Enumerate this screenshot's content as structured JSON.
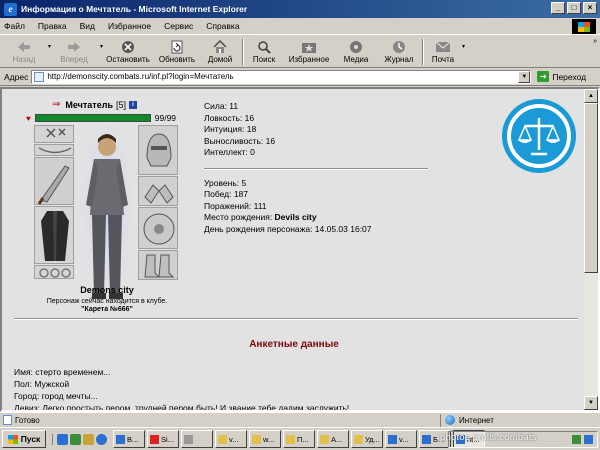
{
  "window": {
    "title": "Информация о Мечтатель - Microsoft Internet Explorer"
  },
  "menu": [
    "Файл",
    "Правка",
    "Вид",
    "Избранное",
    "Сервис",
    "Справка"
  ],
  "toolbar": {
    "back": "Назад",
    "forward": "Вперед",
    "stop": "Остановить",
    "refresh": "Обновить",
    "home": "Домой",
    "search": "Поиск",
    "favorites": "Избранное",
    "media": "Медиа",
    "history": "Журнал",
    "mail": "Почта"
  },
  "address": {
    "label": "Адрес",
    "url": "http://demonscity.combats.ru/inf.pl?login=Мечтатель",
    "go": "Переход"
  },
  "character": {
    "name": "Мечтатель",
    "level": "[5]",
    "info_badge": "i",
    "hp": "99/99",
    "hp_fraction": 1.0,
    "city": "Demons city",
    "location_note": "Персонаж сейчас находится в клубе.",
    "location_place": "\"Карета №666\""
  },
  "stats": {
    "strength": "Сила: 11",
    "agility": "Ловкость: 16",
    "intuition": "Интуиция: 18",
    "endurance": "Выносливость: 16",
    "intellect": "Интеллект: 0"
  },
  "record": {
    "level": "Уровень: 5",
    "wins": "Побед: 187",
    "losses": "Поражений: 111",
    "birthplace_label": "Место рождения: ",
    "birthplace": "Devils city",
    "birthday": "День рождения персонажа: 14.05.03 16:07"
  },
  "profile": {
    "heading": "Анкетные данные",
    "name": "Имя: стерто временем...",
    "gender": "Пол: Мужской",
    "city": "Город: город мечты...",
    "motto": "Девиз: Легко простыть пером, трудней пером быть! И звание тебе дадим заслужить!"
  },
  "statusbar": {
    "left": "Готово",
    "zone": "Интернет"
  },
  "taskbar": {
    "start": "Пуск",
    "tasks": [
      "В...",
      "Si...",
      "",
      "v...",
      "w...",
      "П...",
      "А...",
      "Уд...",
      "v...",
      "Б...",
      "ht...",
      "w..."
    ]
  },
  "watermark": "photos.prolls.combats",
  "colors": {
    "titlebar": "#0a246a",
    "hp": "#0f8a2a",
    "heading": "#7a0b0b",
    "scales": "#1a9ad6"
  }
}
